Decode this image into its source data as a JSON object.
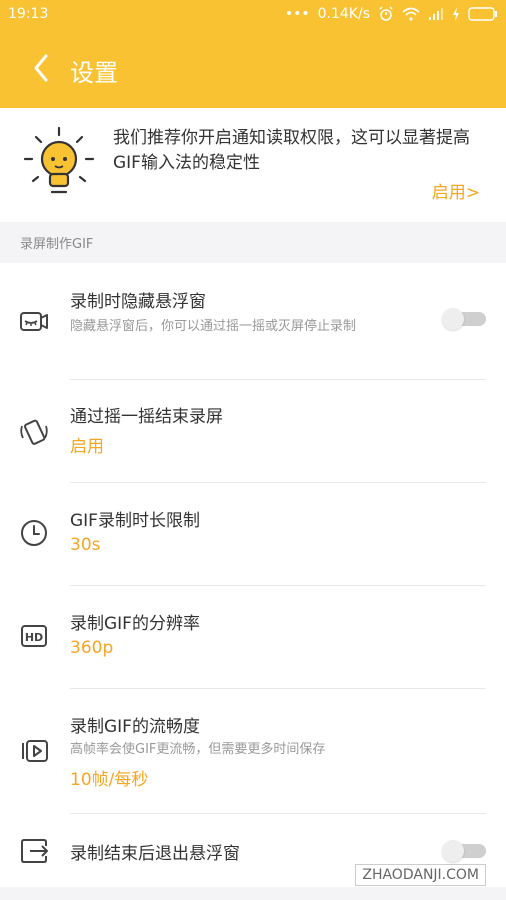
{
  "status_bar": {
    "time": "19:13",
    "network_speed": "0.14K/s",
    "icons": [
      "dots-icon",
      "alarm-icon",
      "wifi-icon",
      "signal-icon",
      "charging-icon",
      "battery-icon"
    ]
  },
  "app_bar": {
    "title": "设置",
    "back_icon": "back-arrow-icon"
  },
  "notice": {
    "icon": "lightbulb-icon",
    "text": "我们推荐你开启通知读取权限，这可以显著提高GIF输入法的稳定性",
    "action_label": "启用>"
  },
  "section": {
    "title": "录屏制作GIF"
  },
  "settings": [
    {
      "icon": "hidden-camera-icon",
      "title": "录制时隐藏悬浮窗",
      "subtitle": "隐藏悬浮窗后，你可以通过摇一摇或灭屏停止录制",
      "toggle": false
    },
    {
      "icon": "shake-phone-icon",
      "title": "通过摇一摇结束录屏",
      "value": "启用"
    },
    {
      "icon": "clock-icon",
      "title": "GIF录制时长限制",
      "value": "30s"
    },
    {
      "icon": "hd-icon",
      "title": "录制GIF的分辨率",
      "value": "360p"
    },
    {
      "icon": "playback-icon",
      "title": "录制GIF的流畅度",
      "subtitle": "高帧率会使GIF更流畅，但需要更多时间保存",
      "value": "10帧/每秒"
    },
    {
      "icon": "exit-icon",
      "title": "录制结束后退出悬浮窗",
      "toggle": false
    }
  ],
  "colors": {
    "brand": "#f8c232",
    "accent": "#f5a623"
  },
  "watermark": "ZHAODANJI.COM"
}
